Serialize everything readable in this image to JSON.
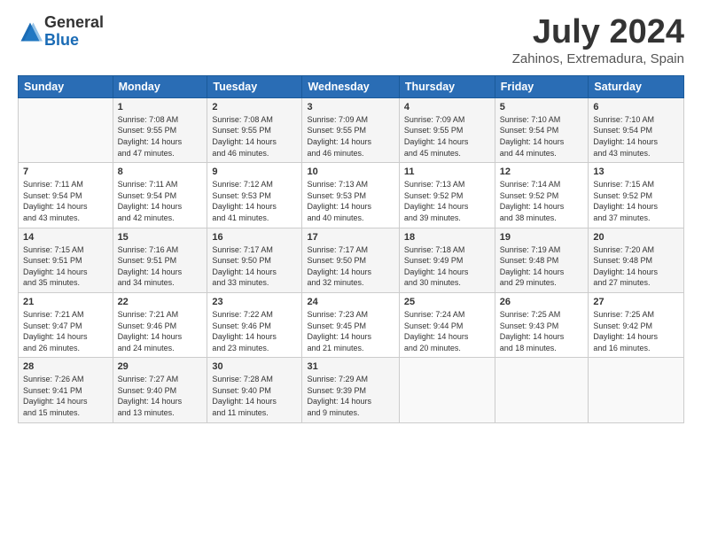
{
  "logo": {
    "general": "General",
    "blue": "Blue"
  },
  "title": "July 2024",
  "location": "Zahinos, Extremadura, Spain",
  "weekdays": [
    "Sunday",
    "Monday",
    "Tuesday",
    "Wednesday",
    "Thursday",
    "Friday",
    "Saturday"
  ],
  "weeks": [
    [
      {
        "day": "",
        "info": ""
      },
      {
        "day": "1",
        "info": "Sunrise: 7:08 AM\nSunset: 9:55 PM\nDaylight: 14 hours\nand 47 minutes."
      },
      {
        "day": "2",
        "info": "Sunrise: 7:08 AM\nSunset: 9:55 PM\nDaylight: 14 hours\nand 46 minutes."
      },
      {
        "day": "3",
        "info": "Sunrise: 7:09 AM\nSunset: 9:55 PM\nDaylight: 14 hours\nand 46 minutes."
      },
      {
        "day": "4",
        "info": "Sunrise: 7:09 AM\nSunset: 9:55 PM\nDaylight: 14 hours\nand 45 minutes."
      },
      {
        "day": "5",
        "info": "Sunrise: 7:10 AM\nSunset: 9:54 PM\nDaylight: 14 hours\nand 44 minutes."
      },
      {
        "day": "6",
        "info": "Sunrise: 7:10 AM\nSunset: 9:54 PM\nDaylight: 14 hours\nand 43 minutes."
      }
    ],
    [
      {
        "day": "7",
        "info": "Sunrise: 7:11 AM\nSunset: 9:54 PM\nDaylight: 14 hours\nand 43 minutes."
      },
      {
        "day": "8",
        "info": "Sunrise: 7:11 AM\nSunset: 9:54 PM\nDaylight: 14 hours\nand 42 minutes."
      },
      {
        "day": "9",
        "info": "Sunrise: 7:12 AM\nSunset: 9:53 PM\nDaylight: 14 hours\nand 41 minutes."
      },
      {
        "day": "10",
        "info": "Sunrise: 7:13 AM\nSunset: 9:53 PM\nDaylight: 14 hours\nand 40 minutes."
      },
      {
        "day": "11",
        "info": "Sunrise: 7:13 AM\nSunset: 9:52 PM\nDaylight: 14 hours\nand 39 minutes."
      },
      {
        "day": "12",
        "info": "Sunrise: 7:14 AM\nSunset: 9:52 PM\nDaylight: 14 hours\nand 38 minutes."
      },
      {
        "day": "13",
        "info": "Sunrise: 7:15 AM\nSunset: 9:52 PM\nDaylight: 14 hours\nand 37 minutes."
      }
    ],
    [
      {
        "day": "14",
        "info": "Sunrise: 7:15 AM\nSunset: 9:51 PM\nDaylight: 14 hours\nand 35 minutes."
      },
      {
        "day": "15",
        "info": "Sunrise: 7:16 AM\nSunset: 9:51 PM\nDaylight: 14 hours\nand 34 minutes."
      },
      {
        "day": "16",
        "info": "Sunrise: 7:17 AM\nSunset: 9:50 PM\nDaylight: 14 hours\nand 33 minutes."
      },
      {
        "day": "17",
        "info": "Sunrise: 7:17 AM\nSunset: 9:50 PM\nDaylight: 14 hours\nand 32 minutes."
      },
      {
        "day": "18",
        "info": "Sunrise: 7:18 AM\nSunset: 9:49 PM\nDaylight: 14 hours\nand 30 minutes."
      },
      {
        "day": "19",
        "info": "Sunrise: 7:19 AM\nSunset: 9:48 PM\nDaylight: 14 hours\nand 29 minutes."
      },
      {
        "day": "20",
        "info": "Sunrise: 7:20 AM\nSunset: 9:48 PM\nDaylight: 14 hours\nand 27 minutes."
      }
    ],
    [
      {
        "day": "21",
        "info": "Sunrise: 7:21 AM\nSunset: 9:47 PM\nDaylight: 14 hours\nand 26 minutes."
      },
      {
        "day": "22",
        "info": "Sunrise: 7:21 AM\nSunset: 9:46 PM\nDaylight: 14 hours\nand 24 minutes."
      },
      {
        "day": "23",
        "info": "Sunrise: 7:22 AM\nSunset: 9:46 PM\nDaylight: 14 hours\nand 23 minutes."
      },
      {
        "day": "24",
        "info": "Sunrise: 7:23 AM\nSunset: 9:45 PM\nDaylight: 14 hours\nand 21 minutes."
      },
      {
        "day": "25",
        "info": "Sunrise: 7:24 AM\nSunset: 9:44 PM\nDaylight: 14 hours\nand 20 minutes."
      },
      {
        "day": "26",
        "info": "Sunrise: 7:25 AM\nSunset: 9:43 PM\nDaylight: 14 hours\nand 18 minutes."
      },
      {
        "day": "27",
        "info": "Sunrise: 7:25 AM\nSunset: 9:42 PM\nDaylight: 14 hours\nand 16 minutes."
      }
    ],
    [
      {
        "day": "28",
        "info": "Sunrise: 7:26 AM\nSunset: 9:41 PM\nDaylight: 14 hours\nand 15 minutes."
      },
      {
        "day": "29",
        "info": "Sunrise: 7:27 AM\nSunset: 9:40 PM\nDaylight: 14 hours\nand 13 minutes."
      },
      {
        "day": "30",
        "info": "Sunrise: 7:28 AM\nSunset: 9:40 PM\nDaylight: 14 hours\nand 11 minutes."
      },
      {
        "day": "31",
        "info": "Sunrise: 7:29 AM\nSunset: 9:39 PM\nDaylight: 14 hours\nand 9 minutes."
      },
      {
        "day": "",
        "info": ""
      },
      {
        "day": "",
        "info": ""
      },
      {
        "day": "",
        "info": ""
      }
    ]
  ]
}
